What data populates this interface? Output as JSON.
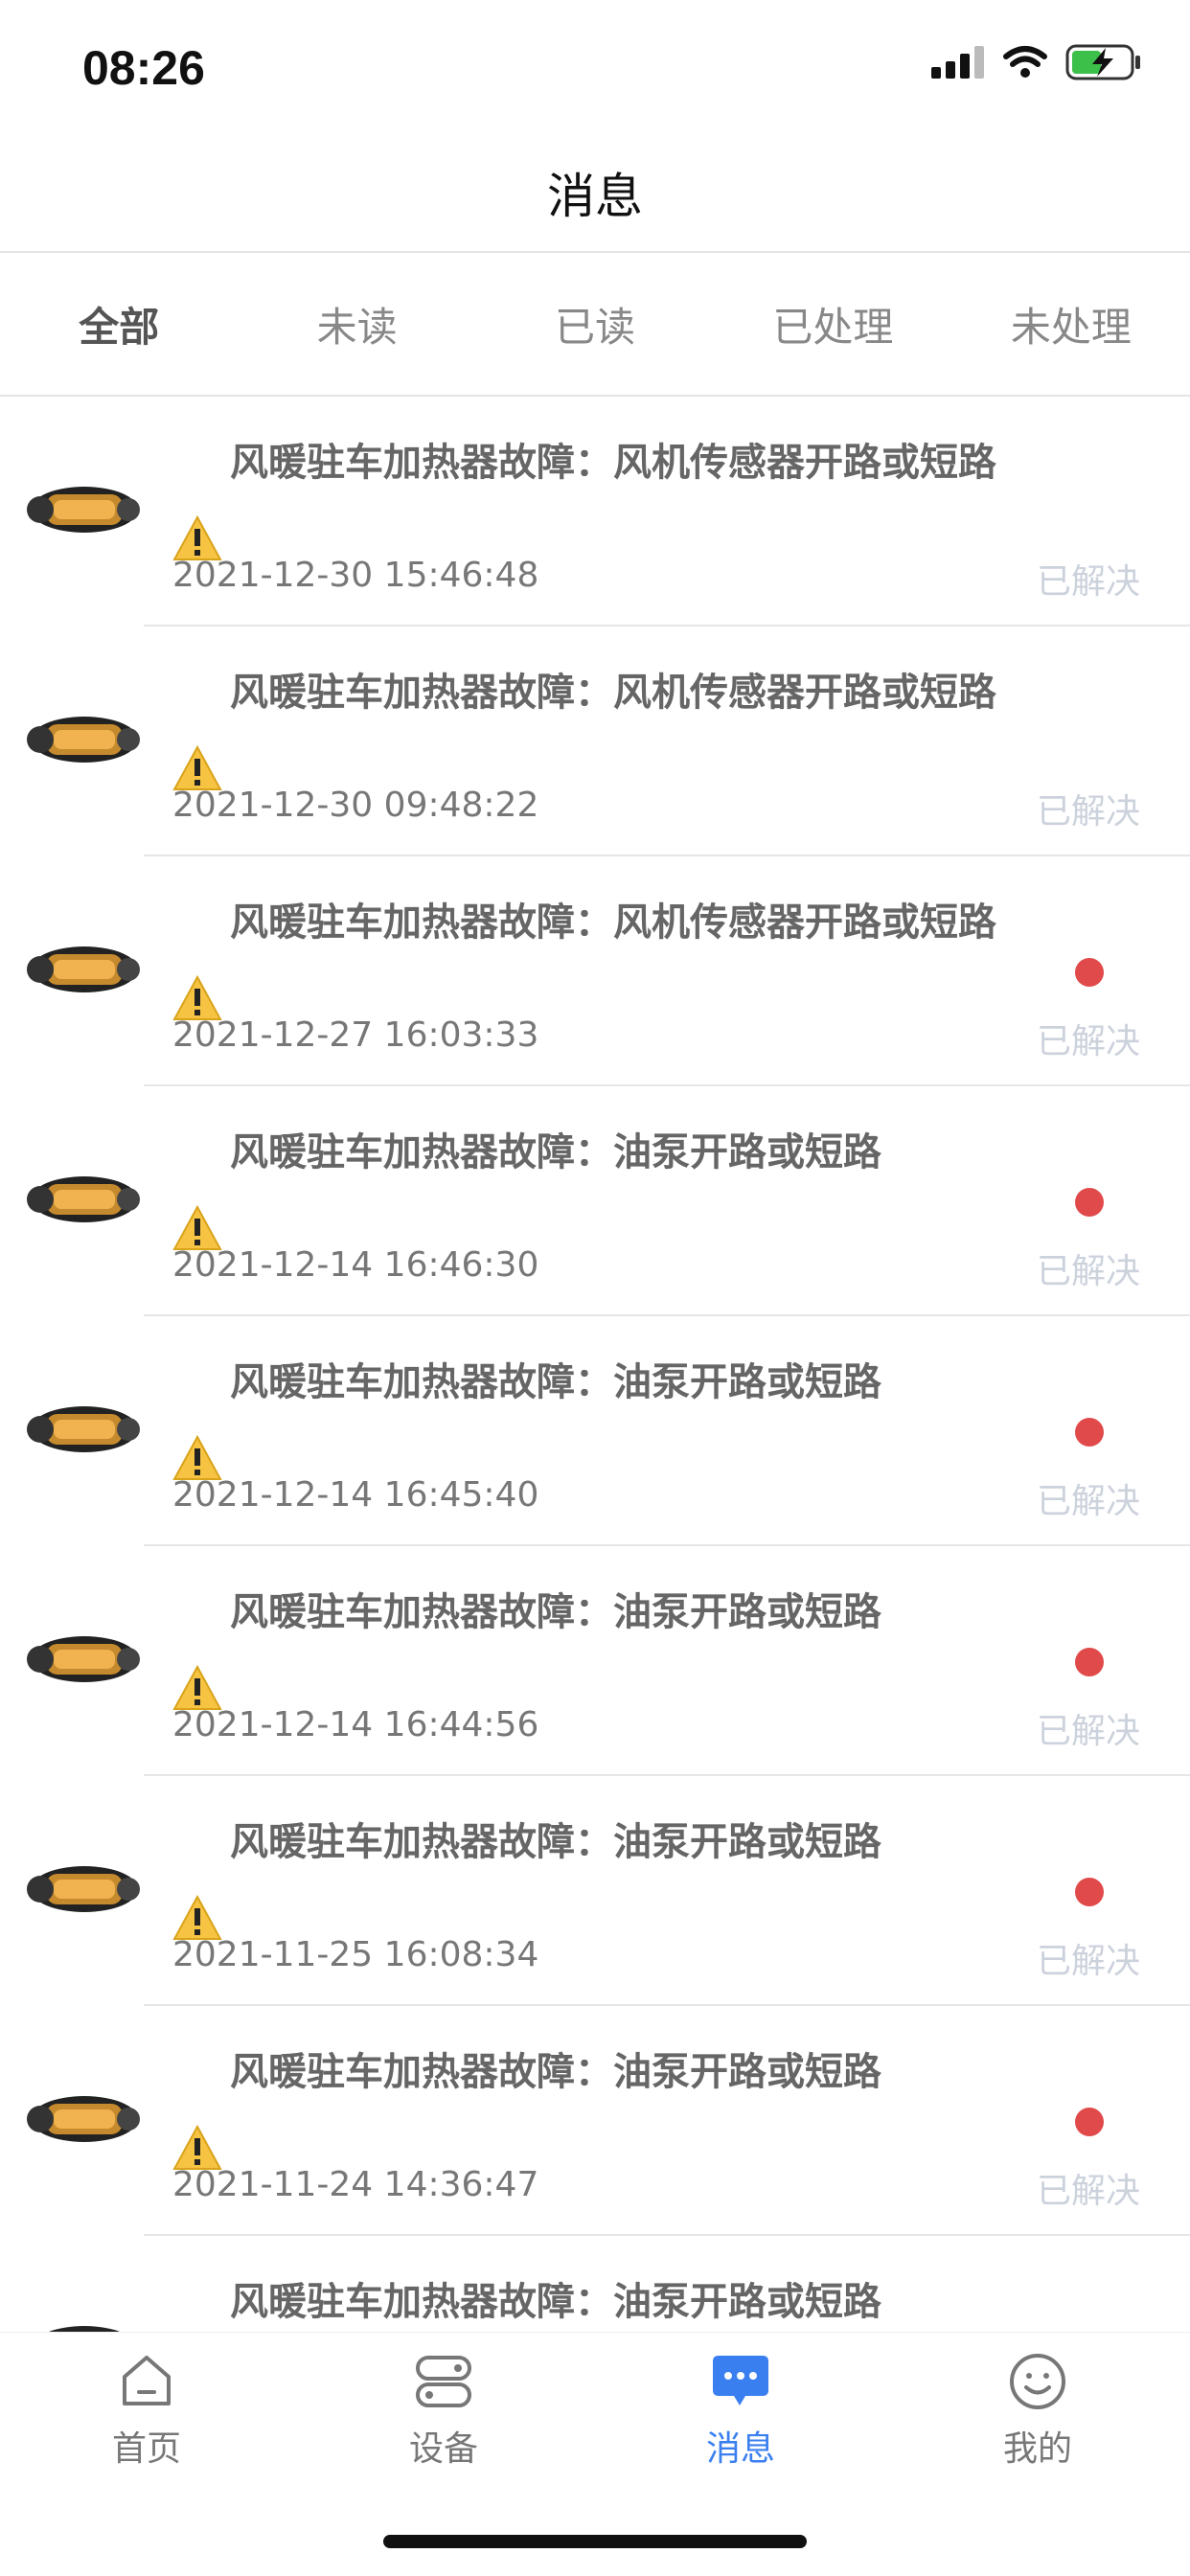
{
  "status": {
    "time": "08:26"
  },
  "header": {
    "title": "消息"
  },
  "tabs": [
    {
      "label": "全部",
      "active": true
    },
    {
      "label": "未读"
    },
    {
      "label": "已读"
    },
    {
      "label": "已处理"
    },
    {
      "label": "未处理"
    }
  ],
  "messages": [
    {
      "title": "风暖驻车加热器故障：风机传感器开路或短路",
      "time": "2021-12-30 15:46:48",
      "state": "已解决",
      "unread": false
    },
    {
      "title": "风暖驻车加热器故障：风机传感器开路或短路",
      "time": "2021-12-30 09:48:22",
      "state": "已解决",
      "unread": false
    },
    {
      "title": "风暖驻车加热器故障：风机传感器开路或短路",
      "time": "2021-12-27 16:03:33",
      "state": "已解决",
      "unread": true
    },
    {
      "title": "风暖驻车加热器故障：油泵开路或短路",
      "time": "2021-12-14 16:46:30",
      "state": "已解决",
      "unread": true
    },
    {
      "title": "风暖驻车加热器故障：油泵开路或短路",
      "time": "2021-12-14 16:45:40",
      "state": "已解决",
      "unread": true
    },
    {
      "title": "风暖驻车加热器故障：油泵开路或短路",
      "time": "2021-12-14 16:44:56",
      "state": "已解决",
      "unread": true
    },
    {
      "title": "风暖驻车加热器故障：油泵开路或短路",
      "time": "2021-11-25 16:08:34",
      "state": "已解决",
      "unread": true
    },
    {
      "title": "风暖驻车加热器故障：油泵开路或短路",
      "time": "2021-11-24 14:36:47",
      "state": "已解决",
      "unread": true
    },
    {
      "title": "风暖驻车加热器故障：油泵开路或短路",
      "time": "",
      "state": "",
      "unread": true
    }
  ],
  "tabbar": [
    {
      "label": "首页",
      "icon": "home-icon"
    },
    {
      "label": "设备",
      "icon": "device-icon"
    },
    {
      "label": "消息",
      "icon": "message-icon",
      "active": true
    },
    {
      "label": "我的",
      "icon": "profile-icon"
    }
  ],
  "colors": {
    "accent": "#3a7ff0",
    "unread_dot": "#e14a4a",
    "resolved": "#ccd2dc"
  }
}
